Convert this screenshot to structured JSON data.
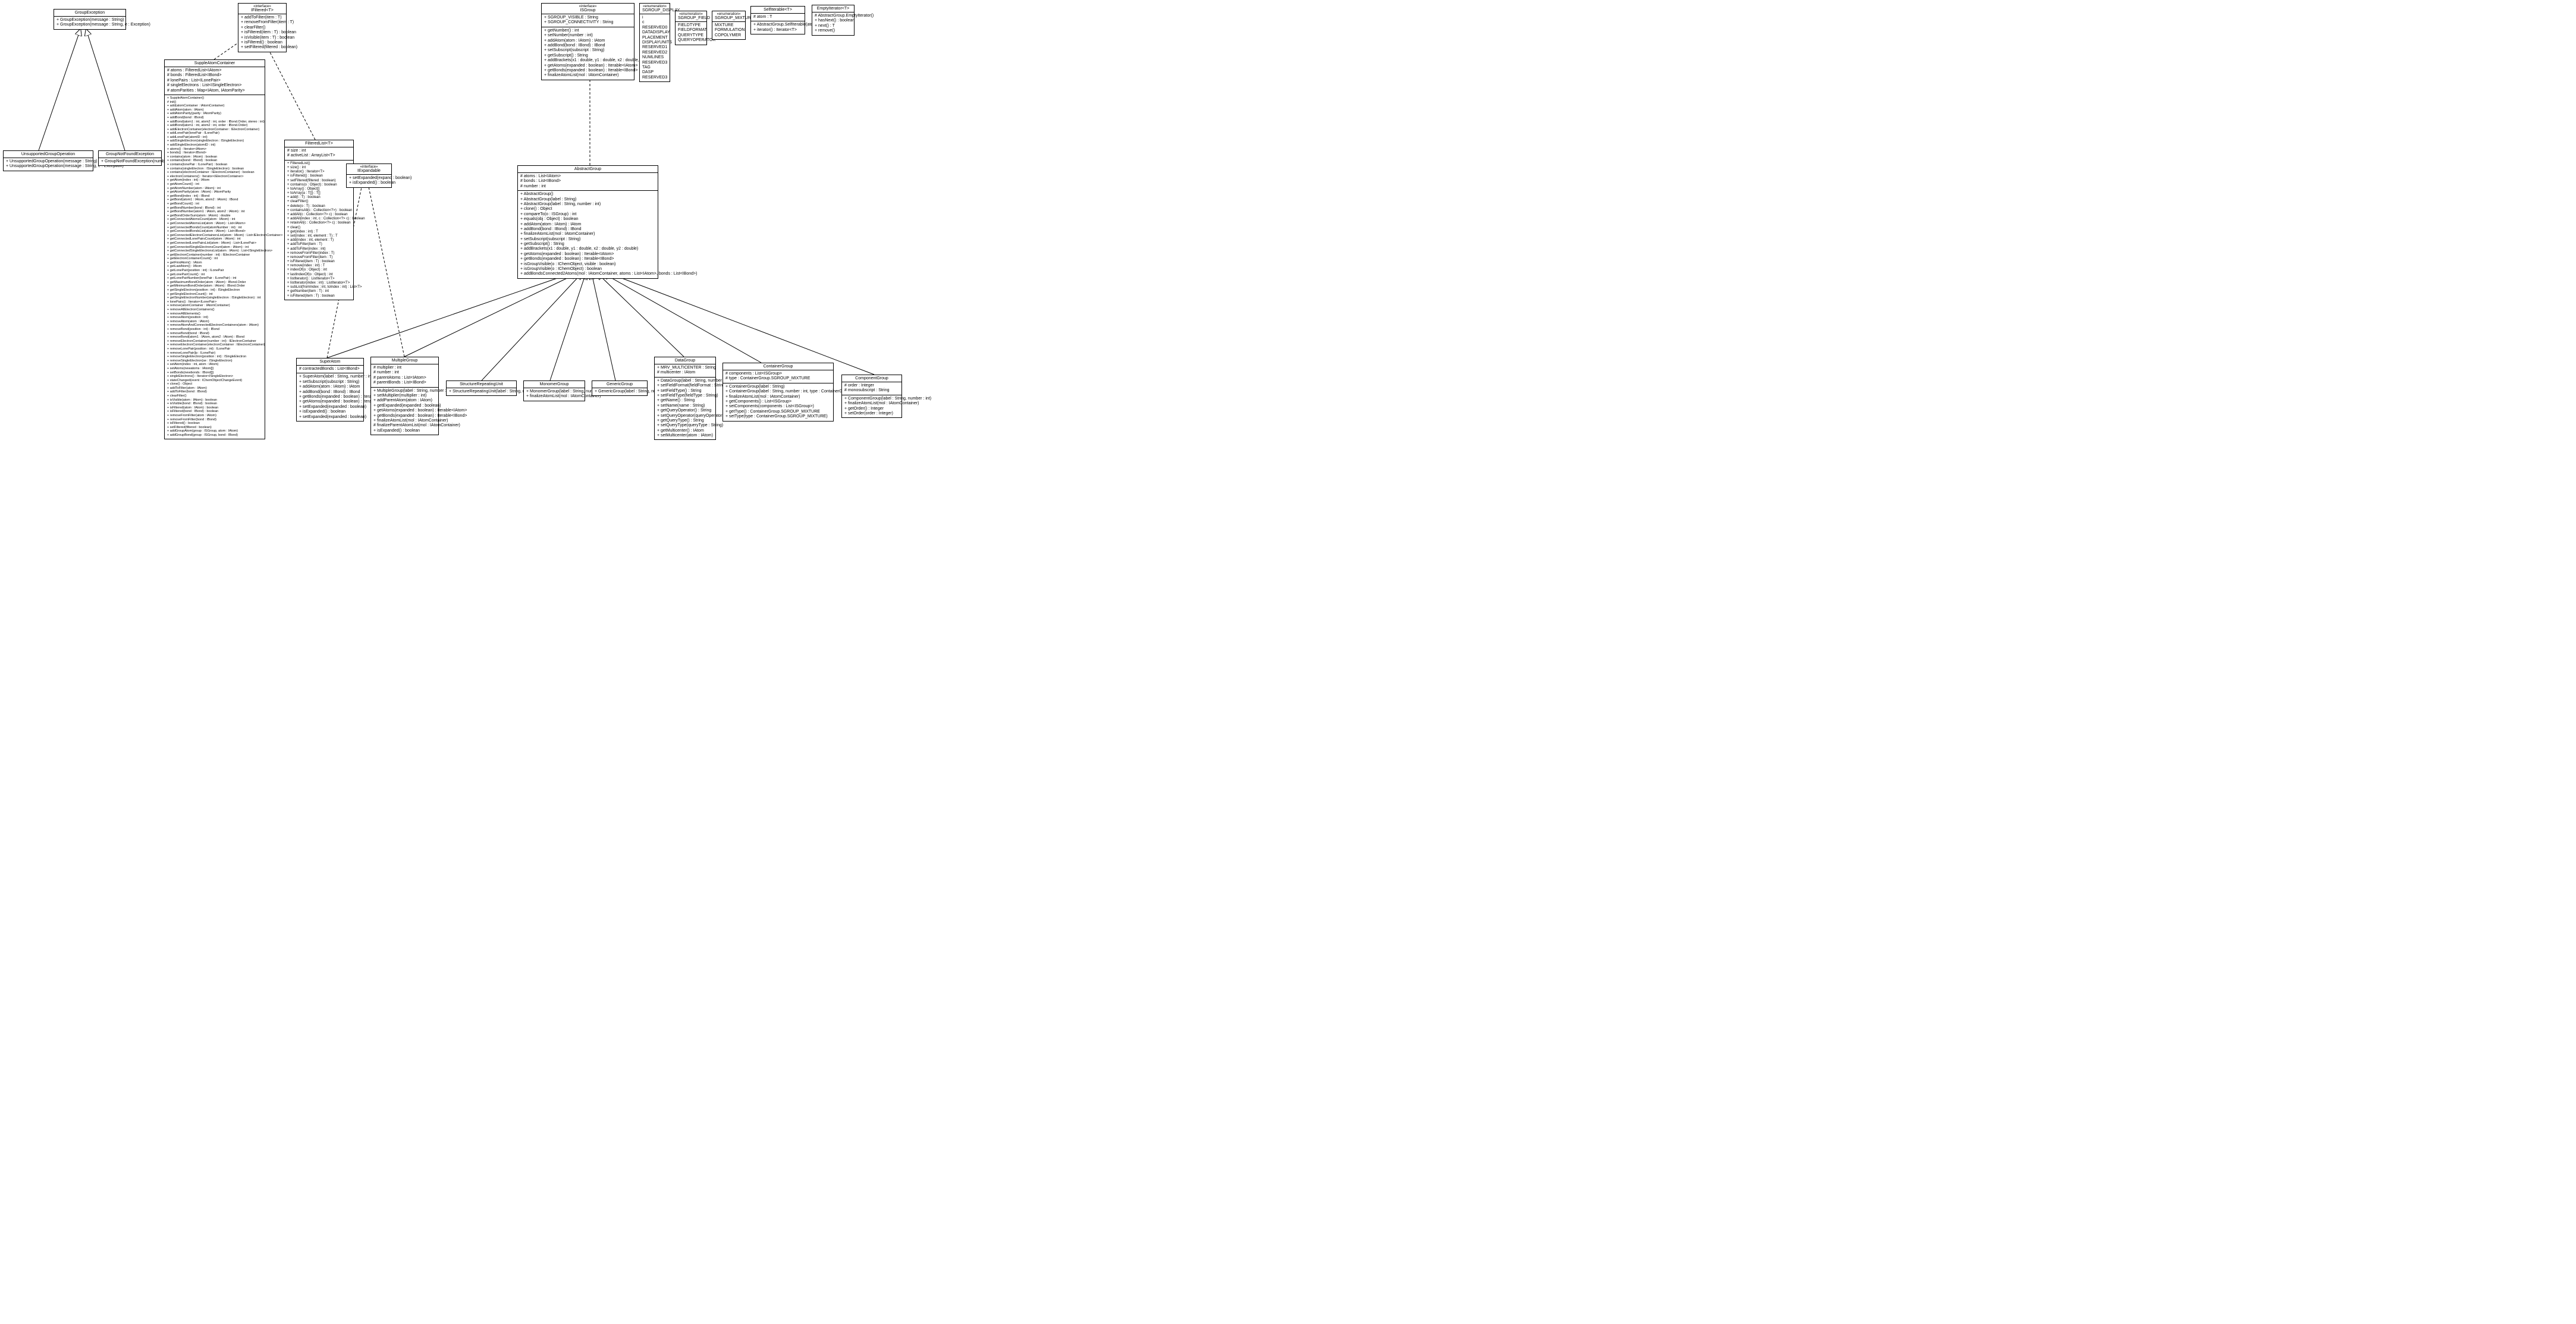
{
  "GroupException": {
    "name": "GroupException",
    "ops": [
      "+ GroupException(message : String)",
      "+ GroupException(message : String, e : Exception)"
    ]
  },
  "UnsupportedGroupOperation": {
    "name": "UnsupportedGroupOperation",
    "ops": [
      "+ UnsupportedGroupOperation(message : String)",
      "+ UnsupportedGroupOperation(message : String, e : Exception)"
    ]
  },
  "GroupNotFoundException": {
    "name": "GroupNotFoundException",
    "ops": [
      "+ GroupNotFoundException(number : String)"
    ]
  },
  "IFiltered": {
    "name": "«interface»\nIFiltered<T>",
    "ops": [
      "+ addToFilter(item : T)",
      "+ removeFromFilter(item : T)",
      "+ clearFilter()",
      "+ isFiltered(item : T) : boolean",
      "+ isVisible(item : T) : boolean",
      "+ isFiltered() : boolean",
      "+ setFiltered(filtered : boolean)"
    ]
  },
  "SuppleAtomContainer": {
    "name": "SuppleAtomContainer",
    "attrs": [
      "# atoms : FilteredList<IAtom>",
      "# bonds : FilteredList<IBond>",
      "# lonePairs : List<ILonePair>",
      "# singleElectrons : List<ISingleElectron>",
      "# atomParities : Map<IAtom, IAtomParity>"
    ],
    "ops": [
      "+ SuppleAtomContainer()",
      "# init()",
      "+ add(atomContainer : IAtomContainer)",
      "+ addAtom(atom : IAtom)",
      "+ addAtomParity(parity : IAtomParity)",
      "+ addBond(bond : IBond)",
      "+ addBond(atom1 : int, atom2 : int, order : IBond.Order, stereo : int)",
      "+ addBond(atom1 : int, atom2 : int, order : IBond.Order)",
      "+ addElectronContainer(electronContainer : IElectronContainer)",
      "+ addLonePair(lonePair : ILonePair)",
      "+ addLonePair(atomID : int)",
      "+ addSingleElectron(singleElectron : ISingleElectron)",
      "+ addSingleElectron(atomID : int)",
      "+ atoms() : Iterator<IAtom>",
      "+ bonds() : Iterator<IBond>",
      "+ contains(atom : IAtom) : boolean",
      "+ contains(bond : IBond) : boolean",
      "+ contains(lonePair : ILonePair) : boolean",
      "+ contains(singleElectron : ISingleElectron) : boolean",
      "+ contains(electronContainer : IElectronContainer) : boolean",
      "+ electronContainers() : Iterator<IElectronContainer>",
      "+ getAtom(index : int) : IAtom",
      "+ getAtomCount() : int",
      "+ getAtomNumber(atom : IAtom) : int",
      "+ getAtomParity(atom : IAtom) : IAtomParity",
      "+ getBond(index : int) : IBond",
      "+ getBond(atom1 : IAtom, atom2 : IAtom) : IBond",
      "+ getBondCount() : int",
      "+ getBondNumber(bond : IBond) : int",
      "+ getBondNumber(atom1 : IAtom, atom2 : IAtom) : int",
      "+ getBondOrderSum(atom : IAtom) : double",
      "+ getConnectedAtomsCount(atom : IAtom) : int",
      "+ getConnectedAtomsList(atom : IAtom) : List<IAtom>",
      "+ getConnectedBondsCount(atomNumber : int) : int",
      "+ getConnectedBondsList(atom : IAtom) : List<IBond>",
      "+ getConnectedElectronContainersList(atom : IAtom) : List<IElectronContainer>",
      "+ getConnectedLonePairsCount(atom : IAtom) : int",
      "+ getConnectedLonePairsList(atom : IAtom) : List<ILonePair>",
      "+ getConnectedSingleElectronsCount(atom : IAtom) : int",
      "+ getConnectedSingleElectronsList(atom : IAtom) : List<ISingleElectron>",
      "+ getElectronContainer(number : int) : IElectronContainer",
      "+ getElectronContainerCount() : int",
      "+ getFirstAtom() : IAtom",
      "+ getLastAtom() : IAtom",
      "+ getLonePair(position : int) : ILonePair",
      "+ getLonePairCount() : int",
      "+ getLonePairNumber(lonePair : ILonePair) : int",
      "+ getMaximumBondOrder(atom : IAtom) : IBond.Order",
      "+ getMinimumBondOrder(atom : IAtom) : IBond.Order",
      "+ getSingleElectron(position : int) : ISingleElectron",
      "+ getSingleElectronCount() : int",
      "+ getSingleElectronNumber(singleElectron : ISingleElectron) : int",
      "+ lonePairs() : Iterator<ILonePair>",
      "+ remove(atomContainer : IAtomContainer)",
      "+ removeAllElectronContainers()",
      "+ removeAllElements()",
      "+ removeAtom(position : int)",
      "+ removeAtom(atom : IAtom)",
      "+ removeAtomAndConnectedElectronContainers(atom : IAtom)",
      "+ removeBond(position : int) : IBond",
      "+ removeBond(bond : IBond)",
      "+ removeBond(atom1 : IAtom, atom2 : IAtom) : IBond",
      "+ removeElectronContainer(number : int) : IElectronContainer",
      "+ removeElectronContainer(electronContainer : IElectronContainer)",
      "+ removeLonePair(position : int) : ILonePair",
      "+ removeLonePair(lp : ILonePair)",
      "+ removeSingleElectron(position : int) : ISingleElectron",
      "+ removeSingleElectron(se : ISingleElectron)",
      "+ setAtom(index : int, atom : IAtom)",
      "+ setAtoms(newatoms : IAtom[])",
      "+ setBonds(newbonds : IBond[])",
      "+ singleElectrons() : Iterator<ISingleElectron>",
      "+ stateChanged(event : IChemObjectChangeEvent)",
      "+ clone() : Object",
      "+ addToFilter(atom : IAtom)",
      "+ addToFilter(bond : IBond)",
      "+ clearFilter()",
      "+ isVisible(atom : IAtom) : boolean",
      "+ isVisible(bond : IBond) : boolean",
      "+ isFiltered(atom : IAtom) : boolean",
      "+ isFiltered(bond : IBond) : boolean",
      "+ removeFromFilter(atom : IAtom)",
      "+ removeFromFilter(bond : IBond)",
      "+ isFiltered() : boolean",
      "+ setFiltered(filtered : boolean)",
      "+ addGroupAtom(group : ISGroup, atom : IAtom)",
      "+ addGroupBond(group : ISGroup, bond : IBond)"
    ]
  },
  "FilteredList": {
    "name": "FilteredList<T>",
    "attrs": [
      "# size : int",
      "# activeList : ArrayList<T>"
    ],
    "ops": [
      "+ FilteredList()",
      "+ size() : int",
      "+ iterator() : Iterator<T>",
      "+ isFiltered() : boolean",
      "+ setFiltered(filtered : boolean)",
      "+ contains(o : Object) : boolean",
      "+ toArray() : Object[]",
      "+ toArray(a : T[]) : T[]",
      "+ add(t : T) : boolean",
      "+ clearFilter()",
      "+ delete(o : T) : boolean",
      "+ containsAll(c : Collection<?>) : boolean",
      "+ addAll(c : Collection<?> c) : boolean",
      "+ addAll(index : int, c : Collection<?> c) : boolean",
      "+ retainAll(c : Collection<?> c) : boolean",
      "+ clear()",
      "+ get(index : int) : T",
      "+ set(index : int, element : T) : T",
      "+ add(index : int, element : T)",
      "+ addToFilter(item : T)",
      "+ addToFilter(index : int)",
      "+ removeFromFilter(index : T)",
      "+ removeFromFilter(item : T)",
      "+ isFiltered(item : T) : boolean",
      "+ remove(index : int) : T",
      "+ indexOf(o : Object) : int",
      "+ lastIndexOf(o : Object) : int",
      "+ listIterator() : ListIterator<T>",
      "+ listIterator(index : int) : ListIterator<T>",
      "+ subList(fromIndex : int, toIndex : int) : List<T>",
      "+ getNumber(item : T) : int",
      "+ isFiltered(item : T) : boolean"
    ]
  },
  "IExpandable": {
    "name": "«interface»\nIExpandable",
    "ops": [
      "+ setExpanded(expand : boolean)",
      "+ isExpanded() : boolean"
    ]
  },
  "ISGroup": {
    "name": "«interface»\nISGroup",
    "attrs": [
      "+ SGROUP_VISIBLE : String",
      "+ SGROUP_CONNECTIVITY : String"
    ],
    "ops": [
      "+ getNumber() : int",
      "+ setNumber(number : int)",
      "+ addAtom(atom : IAtom) : IAtom",
      "+ addBond(bond : IBond) : IBond",
      "+ setSubscript(subscript : String)",
      "+ getSubscript() : String",
      "+ addBrackets(x1 : double, y1 : double, x2 : double, y2 : double)",
      "+ getAtoms(expanded : boolean) : Iterable<IAtom>",
      "+ getBonds(expanded : boolean) : Iterable<IBond>",
      "+ finalizeAtomList(mol : IAtomContainer)"
    ]
  },
  "SGROUP_DISPLAY": {
    "name": "«enumeration»\nSGROUP_DISPLAY",
    "vals": [
      "i",
      "c",
      "RESERVED0",
      "DATADISPLAY",
      "PLACEMENT",
      "DISPLAYUNITS",
      "RESERVED1",
      "RESERVED2",
      "NUMLINES",
      "RESERVED3",
      "TAG",
      "DASP",
      "RESERVED3"
    ]
  },
  "SGROUP_FIELD": {
    "name": "«enumeration»\nSGROUP_FIELD",
    "vals": [
      "FIELDTYPE",
      "FIELDFORMAT",
      "QUERYTYPE",
      "QUERYOPERATOR"
    ]
  },
  "SGROUP_MIXTURE": {
    "name": "«enumeration»\nSGROUP_MIXTURE",
    "vals": [
      "MIXTURE",
      "FORMULATION",
      "COPOLYMER"
    ]
  },
  "SelfIterable": {
    "name": "SelfIterable<T>",
    "attrs": [
      "# atom : T"
    ],
    "ops": [
      "+ AbstractGroup.SelfIterable(atom : T)",
      "+ iterator() : Iterator<T>"
    ]
  },
  "EmptyIterator": {
    "name": "EmptyIterator<T>",
    "ops": [
      "# AbstractGroup.EmptyIterator()",
      "+ hasNext() : boolean",
      "+ next() : T",
      "+ remove()"
    ]
  },
  "AbstractGroup": {
    "name": "AbstractGroup",
    "attrs": [
      "# atoms : List<IAtom>",
      "# bonds : List<IBond>",
      "# number : int"
    ],
    "ops": [
      "+ AbstractGroup()",
      "+ AbstractGroup(label : String)",
      "+ AbstractGroup(label : String, number : int)",
      "+ clone() : Object",
      "+ compareTo(o : ISGroup) : int",
      "+ equals(obj : Object) : boolean",
      "+ addAtom(atom : IAtom) : IAtom",
      "+ addBond(bond : IBond) : IBond",
      "+ finalizeAtomList(mol : IAtomContainer)",
      "+ setSubscript(subscript : String)",
      "+ getSubscript() : String",
      "+ addBrackets(x1 : double, y1 : double, x2 : double, y2 : double)",
      "+ getAtoms(expanded : boolean) : Iterable<IAtom>",
      "+ getBonds(expanded : boolean) : Iterable<IBond>",
      "+ isGroupVisible(o : IChemObject, visible : boolean)",
      "+ isGroupVisible(o : IChemObject) : boolean",
      "+ addBondsConnected2Atoms(mol : IAtomContainer, atoms : List<IAtom>, bonds : List<IBond>)"
    ]
  },
  "SuperAtom": {
    "name": "SuperAtom",
    "attrs": [
      "# contractedBonds : List<IBond>"
    ],
    "ops": [
      "+ SuperAtom(label : String, number : int)",
      "+ setSubscript(subscript : String)",
      "+ addAtom(atom : IAtom) : IAtom",
      "+ addBond(bond : IBond) : IBond",
      "+ getBonds(expanded : boolean) : Iterable<IBond>",
      "+ getAtoms(expanded : boolean) : Iterable<IAtom>",
      "+ setExpanded(expanded : boolean)",
      "+ isExpanded() : boolean",
      "+ setExpanded(expanded : boolean)"
    ]
  },
  "MultipleGroup": {
    "name": "MultipleGroup",
    "attrs": [
      "# multiplier : int",
      "# number : int",
      "# parentAtoms : List<IAtom>",
      "# parentBonds : List<IBond>"
    ],
    "ops": [
      "+ MultipleGroup(label : String, number : int)",
      "+ setMultiplier(multiplier : int)",
      "+ addParentAtom(atom : IAtom)",
      "+ getExpanded(expanded : boolean)",
      "+ getAtoms(expanded : boolean) : Iterable<IAtom>",
      "+ getBonds(expanded : boolean) : Iterable<IBond>",
      "+ finalizeAtomList(mol : IAtomContainer)",
      "# finalizeParentAtomList(mol : IAtomContainer)",
      "+ isExpanded() : boolean"
    ]
  },
  "StructureRepeatingUnit": {
    "name": "StructureRepeatingUnit",
    "ops": [
      "+ StructureRepeatingUnit(label : String, number : int)"
    ]
  },
  "MonomerGroup": {
    "name": "MonomerGroup",
    "ops": [
      "+ MonomerGroup(label : String, number : int)",
      "+ finalizeAtomList(mol : IAtomContainer)"
    ]
  },
  "GenericGroup": {
    "name": "GenericGroup",
    "ops": [
      "+ GenericGroup(label : String, number : int)"
    ]
  },
  "DataGroup": {
    "name": "DataGroup",
    "attrs": [
      "+ MRV_MULTICENTER : String",
      "# multicenter : IAtom"
    ],
    "ops": [
      "+ DataGroup(label : String, number : int)",
      "+ setFieldFormat(fieldFormat : String)",
      "+ setFieldType() : String",
      "+ setFieldType(fieldType : String)",
      "+ getName() : String",
      "+ setName(name : String)",
      "+ getQueryOperator() : String",
      "+ setQueryOperator(queryOperator : String)",
      "+ getQueryType() : String",
      "+ setQueryType(queryType : String)",
      "+ getMulticenter() : IAtom",
      "+ setMulticenter(atom : IAtom)"
    ]
  },
  "ContainerGroup": {
    "name": "ContainerGroup",
    "attrs": [
      "# components : List<ISGroup>",
      "# type : ContainerGroup.SGROUP_MIXTURE"
    ],
    "ops": [
      "+ ContainerGroup(label : String)",
      "+ ContainerGroup(label : String, number : int, type : ContainerGroup.SGROUP_MIXTURE)",
      "+ finalizeAtomList(mol : IAtomContainer)",
      "+ getComponents() : List<ISGroup>",
      "+ setComponents(components : List<ISGroup>)",
      "+ getType() : ContainerGroup.SGROUP_MIXTURE",
      "+ setType(type : ContainerGroup.SGROUP_MIXTURE)"
    ]
  },
  "ComponentGroup": {
    "name": "ComponentGroup",
    "attrs": [
      "# order : Integer",
      "# monosubscript : String"
    ],
    "ops": [
      "+ ComponentGroup(label : String, number : int)",
      "+ finalizeAtomList(mol : IAtomContainer)",
      "+ getOrder() : Integer",
      "+ setOrder(order : Integer)"
    ]
  }
}
